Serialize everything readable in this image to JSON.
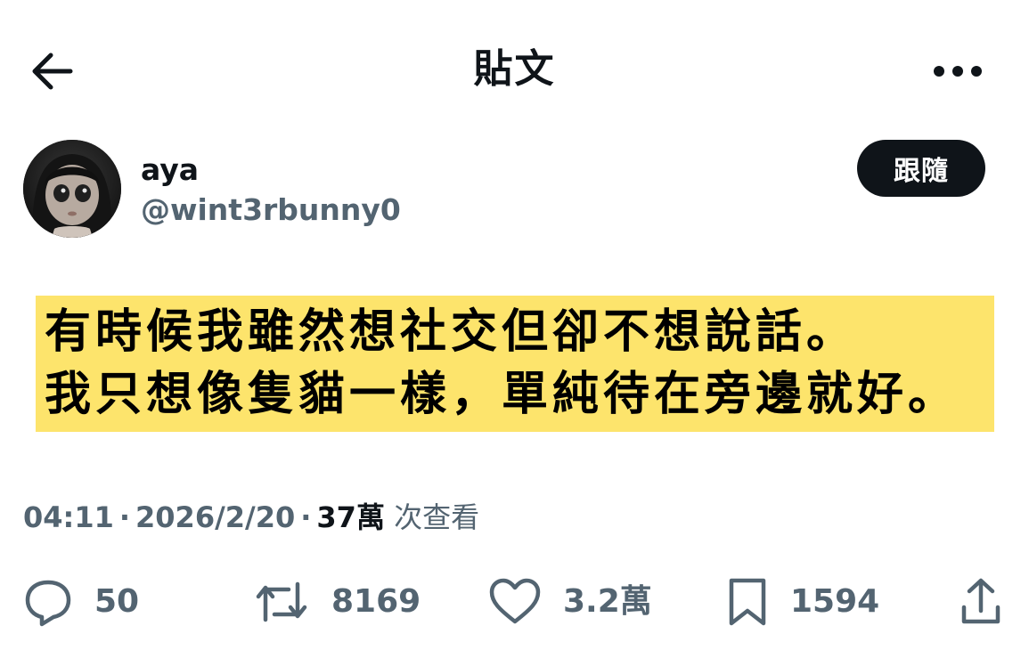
{
  "header": {
    "title": "貼文",
    "back_icon": "arrow-left-icon",
    "more_icon": "more-horizontal-icon"
  },
  "author": {
    "display_name": "aya",
    "handle": "@wint3rbunny0",
    "follow_label": "跟隨"
  },
  "post": {
    "lines": [
      "有時候我雖然想社交但卻不想說話。",
      "我只想像隻貓一樣，單純待在旁邊就好。"
    ],
    "highlight_color": "#fde46c"
  },
  "meta": {
    "time": "04:11",
    "date": "2026/2/20",
    "views_count": "37萬",
    "views_label": "次查看"
  },
  "actions": {
    "replies": "50",
    "reposts": "8169",
    "likes": "3.2萬",
    "bookmarks": "1594"
  },
  "colors": {
    "text": "#0f1419",
    "secondary": "#536471",
    "follow_bg": "#0f1419"
  }
}
